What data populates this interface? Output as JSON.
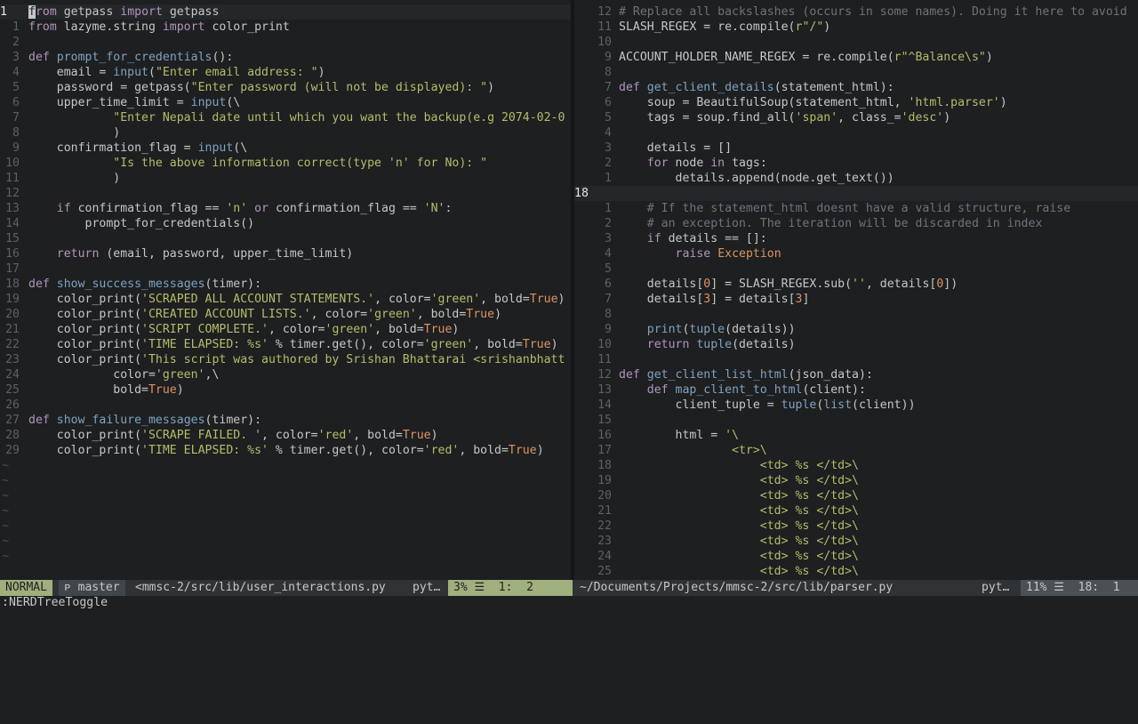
{
  "left": {
    "lines": [
      {
        "n": "1",
        "cur": true,
        "segs": [
          [
            "cursor",
            "f"
          ],
          [
            "kw",
            "rom"
          ],
          [
            "",
            "getpass "
          ],
          [
            "kw",
            "import"
          ],
          [
            "",
            " getpass"
          ]
        ],
        "fix": true
      },
      {
        "n": "1",
        "segs": [
          [
            "kw",
            "from"
          ],
          [
            "",
            " lazyme.string "
          ],
          [
            "kw",
            "import"
          ],
          [
            "",
            " color_print"
          ]
        ]
      },
      {
        "n": "2",
        "segs": []
      },
      {
        "n": "3",
        "segs": [
          [
            "kw",
            "def"
          ],
          [
            "",
            " "
          ],
          [
            "fn",
            "prompt_for_credentials"
          ],
          [
            "",
            "():"
          ]
        ]
      },
      {
        "n": "4",
        "segs": [
          [
            "",
            "    email = "
          ],
          [
            "fn",
            "input"
          ],
          [
            "",
            "("
          ],
          [
            "str",
            "\"Enter email address: \""
          ],
          [
            "",
            ")"
          ]
        ]
      },
      {
        "n": "5",
        "segs": [
          [
            "",
            "    password = getpass("
          ],
          [
            "str",
            "\"Enter password (will not be displayed): \""
          ],
          [
            "",
            ")"
          ]
        ]
      },
      {
        "n": "6",
        "segs": [
          [
            "",
            "    upper_time_limit = "
          ],
          [
            "fn",
            "input"
          ],
          [
            "",
            "(\\"
          ]
        ]
      },
      {
        "n": "7",
        "segs": [
          [
            "",
            "            "
          ],
          [
            "str",
            "\"Enter Nepali date until which you want the backup(e.g 2074-02-0"
          ]
        ]
      },
      {
        "n": "8",
        "segs": [
          [
            "",
            "            )"
          ]
        ]
      },
      {
        "n": "9",
        "segs": [
          [
            "",
            "    confirmation_flag = "
          ],
          [
            "fn",
            "input"
          ],
          [
            "",
            "(\\"
          ]
        ]
      },
      {
        "n": "10",
        "segs": [
          [
            "",
            "            "
          ],
          [
            "str",
            "\"Is the above information correct(type 'n' for No): \""
          ]
        ]
      },
      {
        "n": "11",
        "segs": [
          [
            "",
            "            )"
          ]
        ]
      },
      {
        "n": "12",
        "segs": []
      },
      {
        "n": "13",
        "segs": [
          [
            "",
            "    "
          ],
          [
            "kw",
            "if"
          ],
          [
            "",
            " confirmation_flag == "
          ],
          [
            "str",
            "'n'"
          ],
          [
            "",
            " "
          ],
          [
            "kw",
            "or"
          ],
          [
            "",
            " confirmation_flag == "
          ],
          [
            "str",
            "'N'"
          ],
          [
            "",
            ":"
          ]
        ]
      },
      {
        "n": "14",
        "segs": [
          [
            "",
            "        prompt_for_credentials()"
          ]
        ]
      },
      {
        "n": "15",
        "segs": []
      },
      {
        "n": "16",
        "segs": [
          [
            "",
            "    "
          ],
          [
            "kw",
            "return"
          ],
          [
            "",
            " (email, password, upper_time_limit)"
          ]
        ]
      },
      {
        "n": "17",
        "segs": []
      },
      {
        "n": "18",
        "segs": [
          [
            "kw",
            "def"
          ],
          [
            "",
            " "
          ],
          [
            "fn",
            "show_success_messages"
          ],
          [
            "",
            "(timer):"
          ]
        ]
      },
      {
        "n": "19",
        "segs": [
          [
            "",
            "    color_print("
          ],
          [
            "str",
            "'SCRAPED ALL ACCOUNT STATEMENTS.'"
          ],
          [
            "",
            ", color="
          ],
          [
            "str",
            "'green'"
          ],
          [
            "",
            ", bold="
          ],
          [
            "ex",
            "True"
          ],
          [
            "",
            ")"
          ]
        ]
      },
      {
        "n": "20",
        "segs": [
          [
            "",
            "    color_print("
          ],
          [
            "str",
            "'CREATED ACCOUNT LISTS.'"
          ],
          [
            "",
            ", color="
          ],
          [
            "str",
            "'green'"
          ],
          [
            "",
            ", bold="
          ],
          [
            "ex",
            "True"
          ],
          [
            "",
            ")"
          ]
        ]
      },
      {
        "n": "21",
        "segs": [
          [
            "",
            "    color_print("
          ],
          [
            "str",
            "'SCRIPT COMPLETE.'"
          ],
          [
            "",
            ", color="
          ],
          [
            "str",
            "'green'"
          ],
          [
            "",
            ", bold="
          ],
          [
            "ex",
            "True"
          ],
          [
            "",
            ")"
          ]
        ]
      },
      {
        "n": "22",
        "segs": [
          [
            "",
            "    color_print("
          ],
          [
            "str",
            "'TIME ELAPSED: %s'"
          ],
          [
            "",
            " % timer.get(), color="
          ],
          [
            "str",
            "'green'"
          ],
          [
            "",
            ", bold="
          ],
          [
            "ex",
            "True"
          ],
          [
            "",
            ")"
          ]
        ]
      },
      {
        "n": "23",
        "segs": [
          [
            "",
            "    color_print("
          ],
          [
            "str",
            "'This script was authored by Srishan Bhattarai <srishanbhatt"
          ]
        ]
      },
      {
        "n": "24",
        "segs": [
          [
            "",
            "            color="
          ],
          [
            "str",
            "'green'"
          ],
          [
            "",
            ",\\"
          ]
        ]
      },
      {
        "n": "25",
        "segs": [
          [
            "",
            "            bold="
          ],
          [
            "ex",
            "True"
          ],
          [
            "",
            ")"
          ]
        ]
      },
      {
        "n": "26",
        "segs": []
      },
      {
        "n": "27",
        "segs": [
          [
            "kw",
            "def"
          ],
          [
            "",
            " "
          ],
          [
            "fn",
            "show_failure_messages"
          ],
          [
            "",
            "(timer):"
          ]
        ]
      },
      {
        "n": "28",
        "segs": [
          [
            "",
            "    color_print("
          ],
          [
            "str",
            "'SCRAPE FAILED. '"
          ],
          [
            "",
            ", color="
          ],
          [
            "str",
            "'red'"
          ],
          [
            "",
            ", bold="
          ],
          [
            "ex",
            "True"
          ],
          [
            "",
            ")"
          ]
        ]
      },
      {
        "n": "29",
        "segs": [
          [
            "",
            "    color_print("
          ],
          [
            "str",
            "'TIME ELAPSED: %s'"
          ],
          [
            "",
            " % timer.get(), color="
          ],
          [
            "str",
            "'red'"
          ],
          [
            "",
            ", bold="
          ],
          [
            "ex",
            "True"
          ],
          [
            "",
            ")"
          ]
        ]
      }
    ],
    "tildes": 7
  },
  "right": {
    "lines": [
      {
        "n": "12",
        "segs": [
          [
            "cmt",
            "# Replace all backslashes (occurs in some names). Doing it here to avoid"
          ]
        ]
      },
      {
        "n": "11",
        "segs": [
          [
            "",
            "SLASH_REGEX = re.compile("
          ],
          [
            "str",
            "r\"/\""
          ],
          [
            "",
            ")"
          ]
        ]
      },
      {
        "n": "10",
        "segs": []
      },
      {
        "n": "9",
        "segs": [
          [
            "",
            "ACCOUNT_HOLDER_NAME_REGEX = re.compile("
          ],
          [
            "str",
            "r\"^Balance\\s\""
          ],
          [
            "",
            ")"
          ]
        ]
      },
      {
        "n": "8",
        "segs": []
      },
      {
        "n": "7",
        "segs": [
          [
            "kw",
            "def"
          ],
          [
            "",
            " "
          ],
          [
            "fn",
            "get_client_details"
          ],
          [
            "",
            "(statement_html):"
          ]
        ]
      },
      {
        "n": "6",
        "segs": [
          [
            "",
            "    soup = BeautifulSoup(statement_html, "
          ],
          [
            "str",
            "'html.parser'"
          ],
          [
            "",
            ")"
          ]
        ]
      },
      {
        "n": "5",
        "segs": [
          [
            "",
            "    tags = soup.find_all("
          ],
          [
            "str",
            "'span'"
          ],
          [
            "",
            ", class_="
          ],
          [
            "str",
            "'desc'"
          ],
          [
            "",
            ")"
          ]
        ]
      },
      {
        "n": "4",
        "segs": []
      },
      {
        "n": "3",
        "segs": [
          [
            "",
            "    details = []"
          ]
        ]
      },
      {
        "n": "2",
        "segs": [
          [
            "",
            "    "
          ],
          [
            "kw",
            "for"
          ],
          [
            "",
            " node "
          ],
          [
            "kw",
            "in"
          ],
          [
            "",
            " tags:"
          ]
        ]
      },
      {
        "n": "1",
        "segs": [
          [
            "",
            "        details.append(node.get_text())"
          ]
        ]
      },
      {
        "n": "18",
        "cur": true,
        "segs": []
      },
      {
        "n": "1",
        "segs": [
          [
            "",
            "    "
          ],
          [
            "cmt",
            "# If the statement_html doesnt have a valid structure, raise"
          ]
        ]
      },
      {
        "n": "2",
        "segs": [
          [
            "",
            "    "
          ],
          [
            "cmt",
            "# an exception. The iteration will be discarded in index"
          ]
        ]
      },
      {
        "n": "3",
        "segs": [
          [
            "",
            "    "
          ],
          [
            "kw",
            "if"
          ],
          [
            "",
            " details == []:"
          ]
        ]
      },
      {
        "n": "4",
        "segs": [
          [
            "",
            "        "
          ],
          [
            "kw",
            "raise"
          ],
          [
            "",
            " "
          ],
          [
            "ex",
            "Exception"
          ]
        ]
      },
      {
        "n": "5",
        "segs": []
      },
      {
        "n": "6",
        "segs": [
          [
            "",
            "    details["
          ],
          [
            "ex",
            "0"
          ],
          [
            "",
            "] = SLASH_REGEX.sub("
          ],
          [
            "str",
            "''"
          ],
          [
            "",
            ", details["
          ],
          [
            "ex",
            "0"
          ],
          [
            "",
            "])"
          ]
        ]
      },
      {
        "n": "7",
        "segs": [
          [
            "",
            "    details["
          ],
          [
            "ex",
            "3"
          ],
          [
            "",
            "] = details["
          ],
          [
            "ex",
            "3"
          ],
          [
            "",
            "]"
          ]
        ]
      },
      {
        "n": "8",
        "segs": []
      },
      {
        "n": "9",
        "segs": [
          [
            "",
            "    "
          ],
          [
            "fn",
            "print"
          ],
          [
            "",
            "("
          ],
          [
            "fn",
            "tuple"
          ],
          [
            "",
            "(details))"
          ]
        ]
      },
      {
        "n": "10",
        "segs": [
          [
            "",
            "    "
          ],
          [
            "kw",
            "return"
          ],
          [
            "",
            " "
          ],
          [
            "fn",
            "tuple"
          ],
          [
            "",
            "(details)"
          ]
        ]
      },
      {
        "n": "11",
        "segs": []
      },
      {
        "n": "12",
        "segs": [
          [
            "kw",
            "def"
          ],
          [
            "",
            " "
          ],
          [
            "fn",
            "get_client_list_html"
          ],
          [
            "",
            "(json_data):"
          ]
        ]
      },
      {
        "n": "13",
        "segs": [
          [
            "",
            "    "
          ],
          [
            "kw",
            "def"
          ],
          [
            "",
            " "
          ],
          [
            "fn",
            "map_client_to_html"
          ],
          [
            "",
            "(client):"
          ]
        ]
      },
      {
        "n": "14",
        "segs": [
          [
            "",
            "        client_tuple = "
          ],
          [
            "fn",
            "tuple"
          ],
          [
            "",
            "("
          ],
          [
            "fn",
            "list"
          ],
          [
            "",
            "(client))"
          ]
        ]
      },
      {
        "n": "15",
        "segs": []
      },
      {
        "n": "16",
        "segs": [
          [
            "",
            "        html = "
          ],
          [
            "str",
            "'\\"
          ]
        ]
      },
      {
        "n": "17",
        "segs": [
          [
            "",
            "                "
          ],
          [
            "str",
            "<tr>\\"
          ]
        ]
      },
      {
        "n": "18",
        "segs": [
          [
            "",
            "                    "
          ],
          [
            "str",
            "<td> %s </td>\\"
          ]
        ]
      },
      {
        "n": "19",
        "segs": [
          [
            "",
            "                    "
          ],
          [
            "str",
            "<td> %s </td>\\"
          ]
        ]
      },
      {
        "n": "20",
        "segs": [
          [
            "",
            "                    "
          ],
          [
            "str",
            "<td> %s </td>\\"
          ]
        ]
      },
      {
        "n": "21",
        "segs": [
          [
            "",
            "                    "
          ],
          [
            "str",
            "<td> %s </td>\\"
          ]
        ]
      },
      {
        "n": "22",
        "segs": [
          [
            "",
            "                    "
          ],
          [
            "str",
            "<td> %s </td>\\"
          ]
        ]
      },
      {
        "n": "23",
        "segs": [
          [
            "",
            "                    "
          ],
          [
            "str",
            "<td> %s </td>\\"
          ]
        ]
      },
      {
        "n": "24",
        "segs": [
          [
            "",
            "                    "
          ],
          [
            "str",
            "<td> %s </td>\\"
          ]
        ]
      },
      {
        "n": "25",
        "segs": [
          [
            "",
            "                    "
          ],
          [
            "str",
            "<td> %s </td>\\"
          ]
        ]
      }
    ]
  },
  "status": {
    "mode": "NORMAL",
    "branch": "ᴘ master",
    "left_file": "<mmsc-2/src/lib/user_interactions.py",
    "left_ftype": "pyt…",
    "left_pct": "3% ☰  1:  2",
    "right_file": "~/Documents/Projects/mmsc-2/src/lib/parser.py",
    "right_ftype": "pyt…",
    "right_pct": "11% ☰  18:  1"
  },
  "cmdline": ":NERDTreeToggle"
}
